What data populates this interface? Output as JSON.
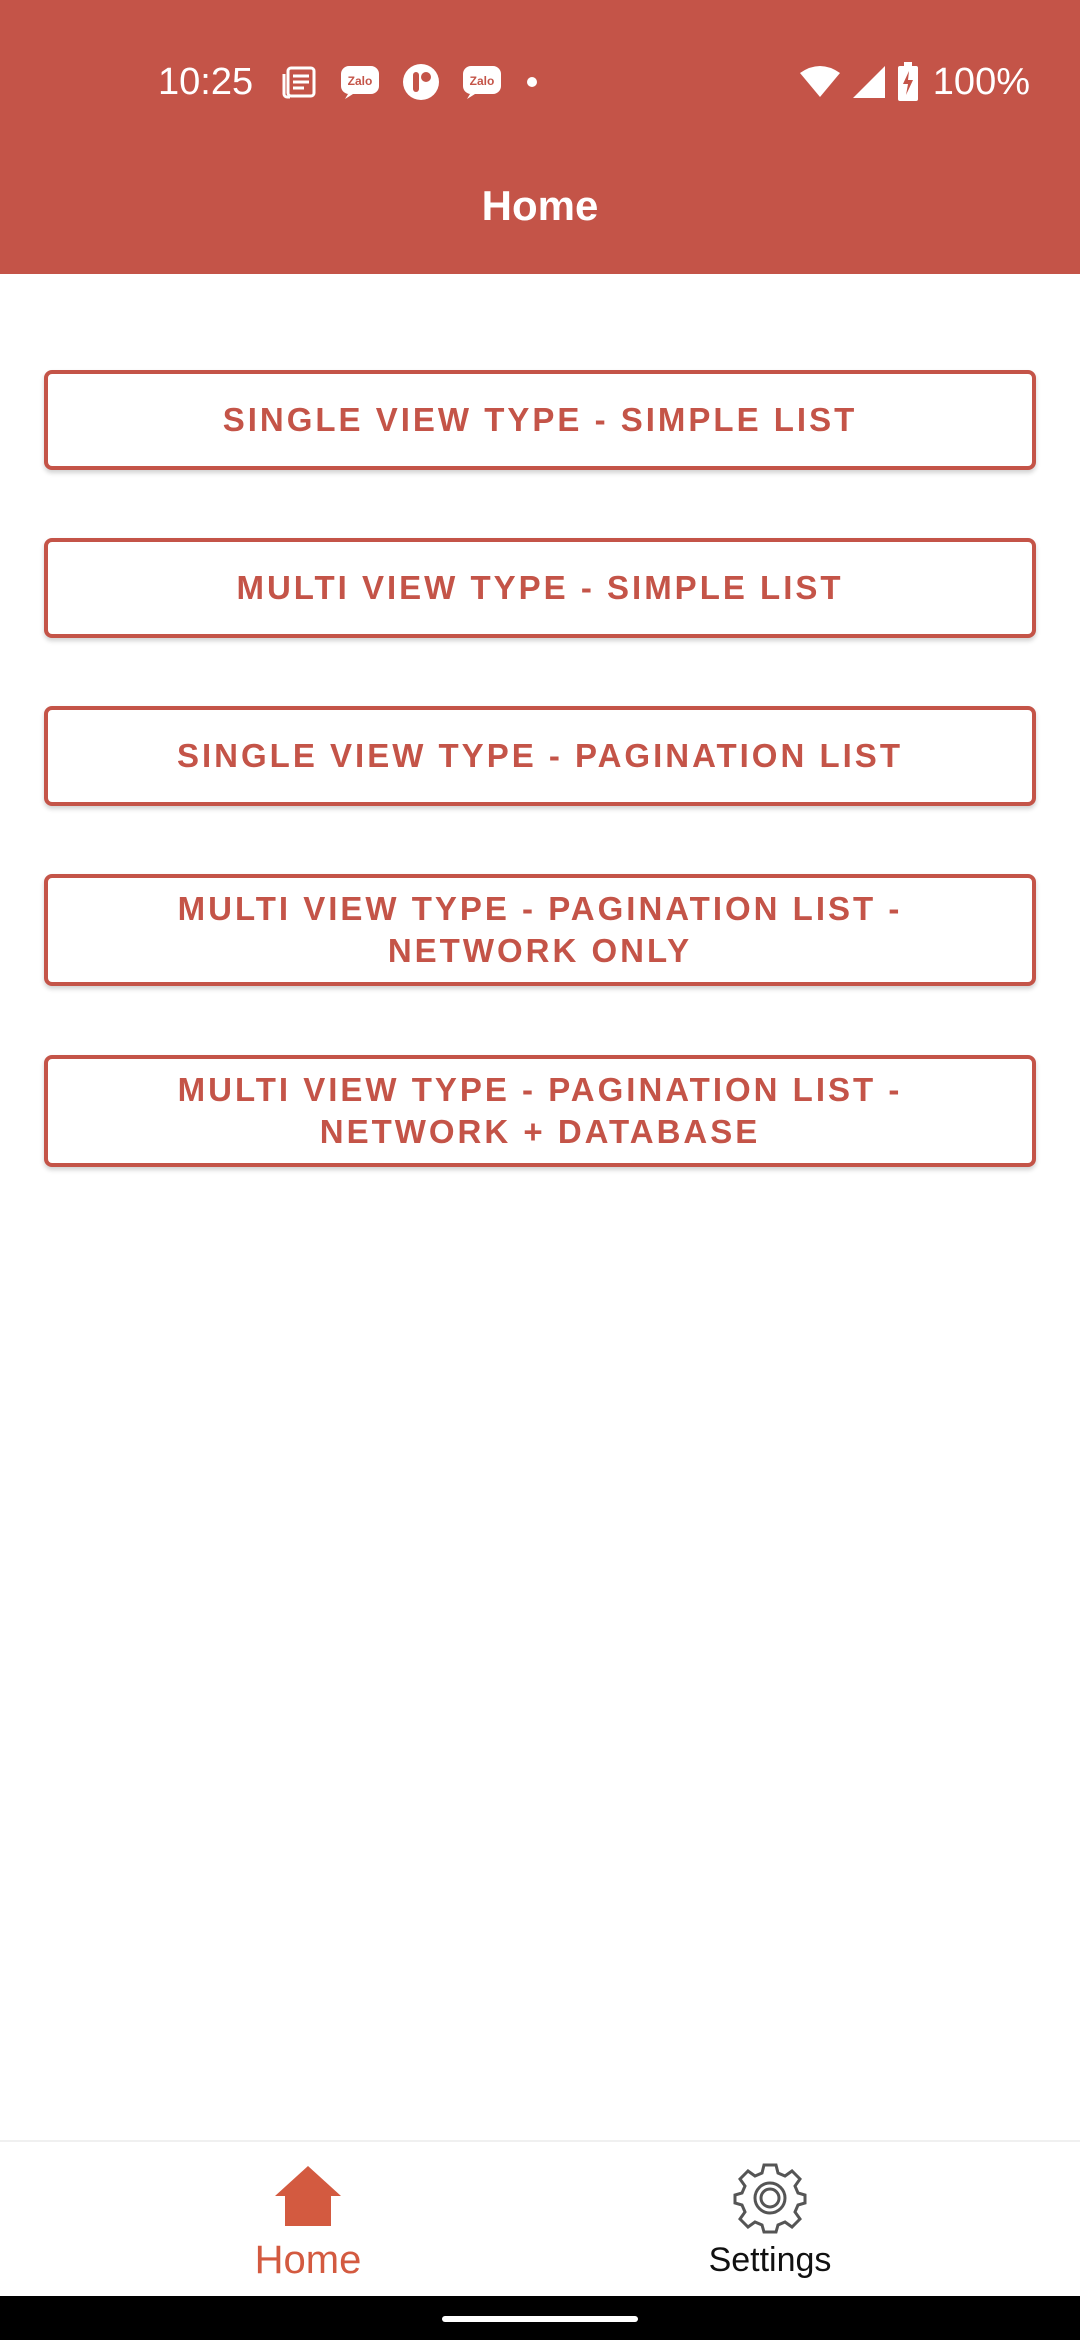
{
  "status_bar": {
    "time": "10:25",
    "battery": "100%",
    "notification_icons": [
      "news-icon",
      "zalo-icon",
      "app-icon",
      "zalo-icon",
      "dot-icon"
    ],
    "system_icons": [
      "wifi-icon",
      "signal-icon",
      "battery-charging-icon"
    ]
  },
  "header": {
    "title": "Home"
  },
  "buttons": [
    {
      "label": "SINGLE VIEW TYPE - SIMPLE LIST"
    },
    {
      "label": "MULTI VIEW TYPE - SIMPLE LIST"
    },
    {
      "label": "SINGLE VIEW TYPE - PAGINATION LIST"
    },
    {
      "label": "MULTI VIEW TYPE - PAGINATION LIST - NETWORK ONLY"
    },
    {
      "label": "MULTI VIEW TYPE - PAGINATION LIST - NETWORK + DATABASE"
    }
  ],
  "bottom_nav": {
    "items": [
      {
        "label": "Home",
        "icon": "home-icon",
        "selected": true
      },
      {
        "label": "Settings",
        "icon": "gear-icon",
        "selected": false
      }
    ]
  },
  "colors": {
    "primary": "#c45448",
    "nav_active": "#d35a40",
    "background": "#ffffff"
  }
}
